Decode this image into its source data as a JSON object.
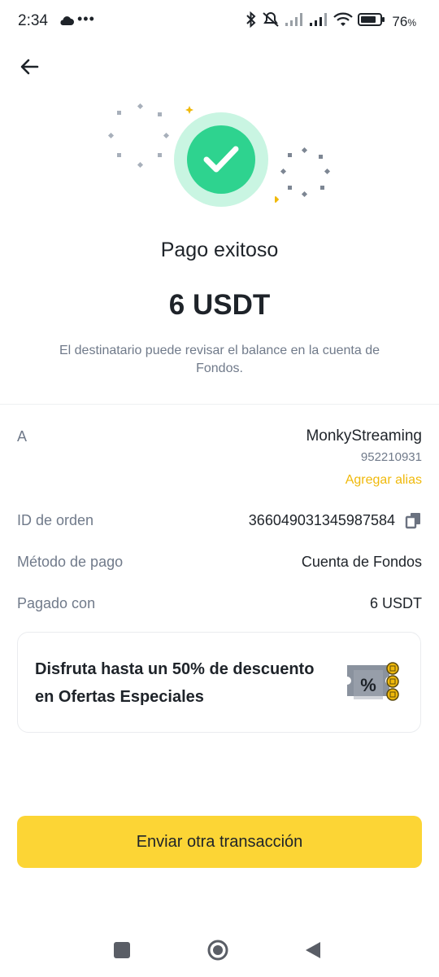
{
  "status_bar": {
    "time": "2:34",
    "dots": "•••",
    "battery_percent": "76",
    "battery_unit": "%"
  },
  "header": {
    "back_icon": "arrow-left-icon"
  },
  "result": {
    "title": "Pago exitoso",
    "amount": "6 USDT",
    "note": "El destinatario puede revisar el balance en la cuenta de Fondos."
  },
  "details": {
    "to_label": "A",
    "recipient_name": "MonkyStreaming",
    "recipient_id": "952210931",
    "add_alias": "Agregar alias",
    "order_label": "ID de orden",
    "order_id": "366049031345987584",
    "method_label": "Método de pago",
    "method_value": "Cuenta de Fondos",
    "paid_label": "Pagado con",
    "paid_value": "6 USDT"
  },
  "promo": {
    "text": "Disfruta hasta un 50% de descuento en Ofertas Especiales"
  },
  "cta": {
    "label": "Enviar otra transacción"
  },
  "colors": {
    "accent": "#fcd535",
    "link": "#f0b90b",
    "success": "#2ed38f",
    "success_ring": "#c9f5e2"
  }
}
